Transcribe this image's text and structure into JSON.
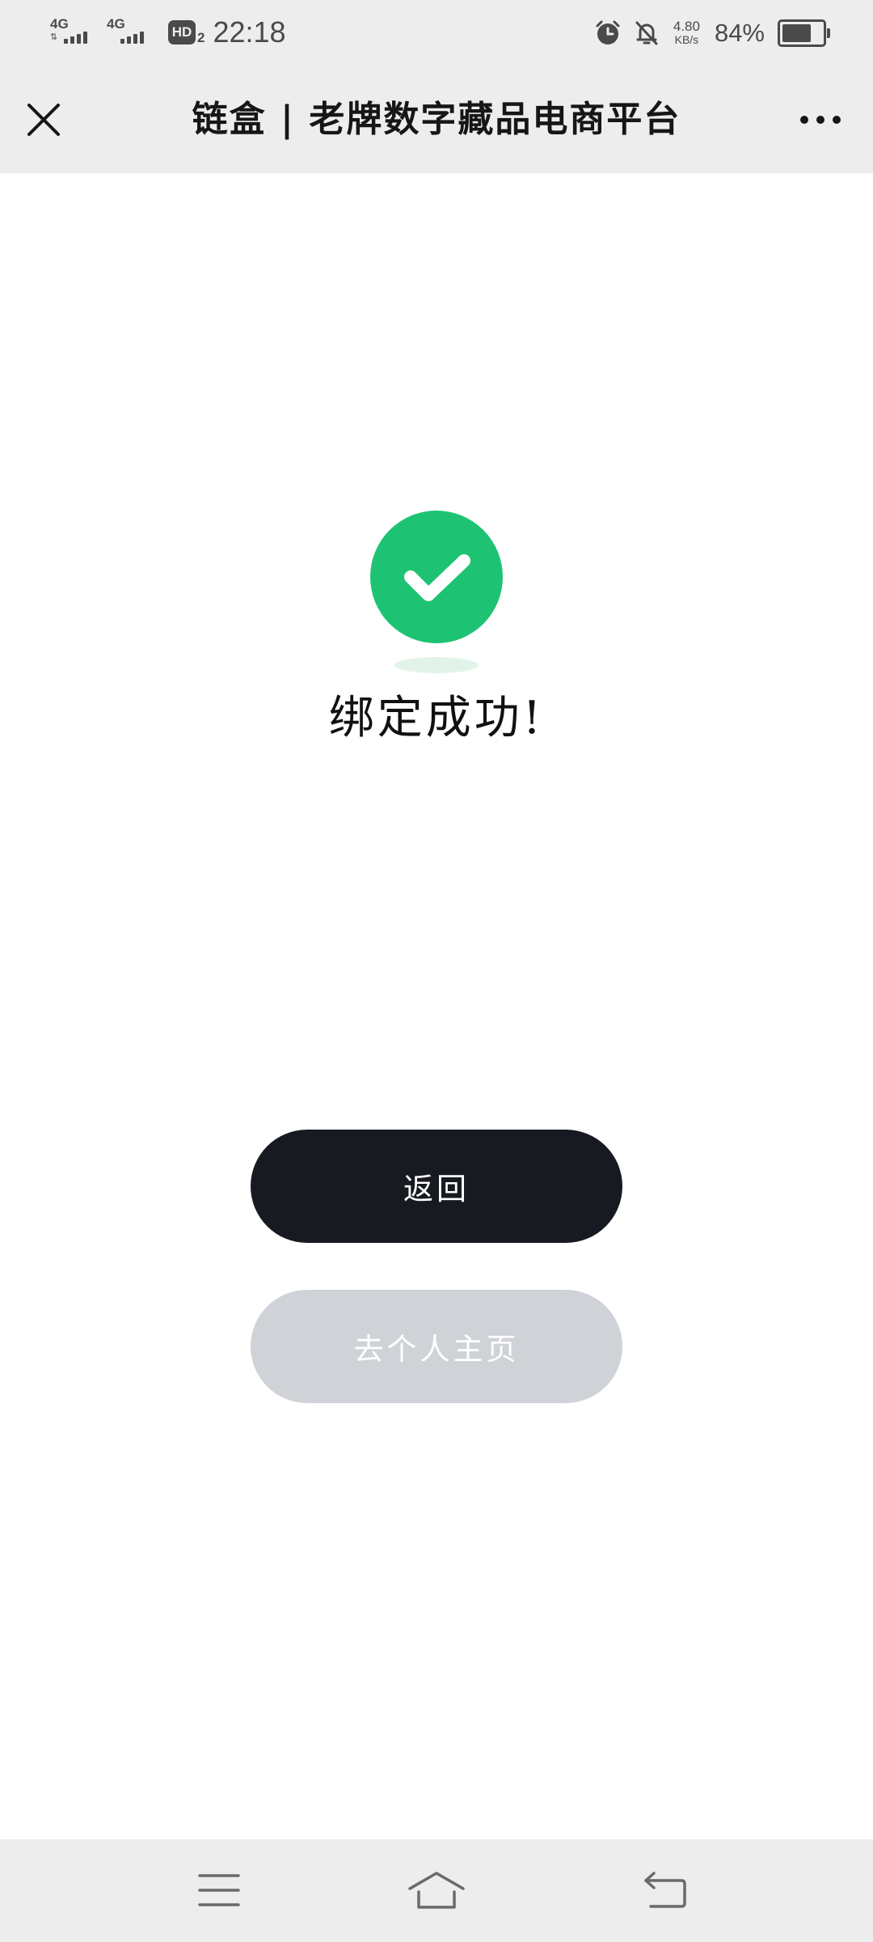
{
  "status_bar": {
    "network1": "4G",
    "network2": "4G",
    "hd_label": "HD",
    "hd_sub": "2",
    "time": "22:18",
    "speed_value": "4.80",
    "speed_unit": "KB/s",
    "battery_percent": "84%",
    "battery_level": 0.84,
    "icons": [
      "alarm-icon",
      "notifications-off-icon",
      "battery-icon"
    ]
  },
  "header": {
    "title": "链盒 | 老牌数字藏品电商平台",
    "close_icon": "close-icon",
    "more_icon": "more-icon"
  },
  "main": {
    "success_icon": "checkmark-icon",
    "success_color": "#1dc373",
    "message": "绑定成功!",
    "back_button_label": "返回",
    "profile_button_label": "去个人主页"
  },
  "nav_bar": {
    "icons": [
      "menu-icon",
      "home-icon",
      "back-icon"
    ]
  },
  "colors": {
    "primary_button": "#171a20",
    "disabled_button": "#cfd2d7",
    "bar_background": "#ededed"
  }
}
